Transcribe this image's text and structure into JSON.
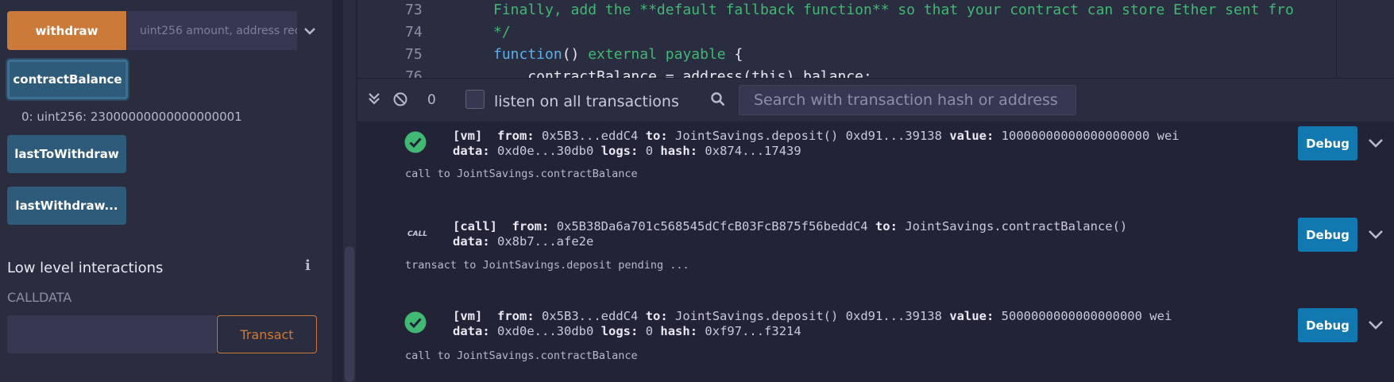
{
  "left_panel": {
    "withdraw_label": "withdraw",
    "withdraw_placeholder": "uint256 amount, address recipient",
    "contract_balance_label": "contractBalance",
    "contract_balance_output": "0: uint256: 23000000000000000001",
    "last_to_withdraw_label": "lastToWithdraw",
    "last_withdraw_amount_label": "lastWithdraw...",
    "low_level_title": "Low level interactions",
    "calldata_label": "CALLDATA",
    "transact_label": "Transact"
  },
  "editor": {
    "lines": [
      {
        "num": "73",
        "text": "Finally, add the **default fallback function** so that your contract can store Ether sent fro"
      },
      {
        "num": "74",
        "text": "*/"
      },
      {
        "num": "75",
        "kw": "function",
        "mid": "() ",
        "mod1": "external",
        "mod2": "payable",
        "end": " {"
      },
      {
        "num": "76",
        "text": "    contractBalance = address(this).balance;"
      }
    ]
  },
  "terminal": {
    "count": "0",
    "listen_label": "listen on all transactions",
    "search_placeholder": "Search with transaction hash or address",
    "entries": [
      {
        "status": "success",
        "tag": "[vm]",
        "from_label": "from:",
        "from": "0x5B3...eddC4",
        "to_label": "to:",
        "to": "JointSavings.deposit() 0xd91...39138",
        "value_label": "value:",
        "value": "10000000000000000000 wei",
        "data_label": "data:",
        "data": "0xd0e...30db0",
        "logs_label": "logs:",
        "logs": "0",
        "hash_label": "hash:",
        "hash": "0x874...17439",
        "message": "call to JointSavings.contractBalance",
        "debug_label": "Debug"
      },
      {
        "status": "call",
        "call_tag": "CALL",
        "tag": "[call]",
        "from_label": "from:",
        "from": "0x5B38Da6a701c568545dCfcB03FcB875f56beddC4",
        "to_label": "to:",
        "to": "JointSavings.contractBalance()",
        "data_label": "data:",
        "data": "0x8b7...afe2e",
        "message": "transact to JointSavings.deposit pending ...",
        "debug_label": "Debug"
      },
      {
        "status": "success",
        "tag": "[vm]",
        "from_label": "from:",
        "from": "0x5B3...eddC4",
        "to_label": "to:",
        "to": "JointSavings.deposit() 0xd91...39138",
        "value_label": "value:",
        "value": "5000000000000000000 wei",
        "data_label": "data:",
        "data": "0xd0e...30db0",
        "logs_label": "logs:",
        "logs": "0",
        "hash_label": "hash:",
        "hash": "0xf97...f3214",
        "message": "call to JointSavings.contractBalance",
        "debug_label": "Debug"
      }
    ]
  },
  "colors": {
    "accent_orange": "#cc7a3a",
    "button_blue": "#2f5b7a",
    "debug_blue": "#1279b0",
    "success_green": "#41b873"
  }
}
